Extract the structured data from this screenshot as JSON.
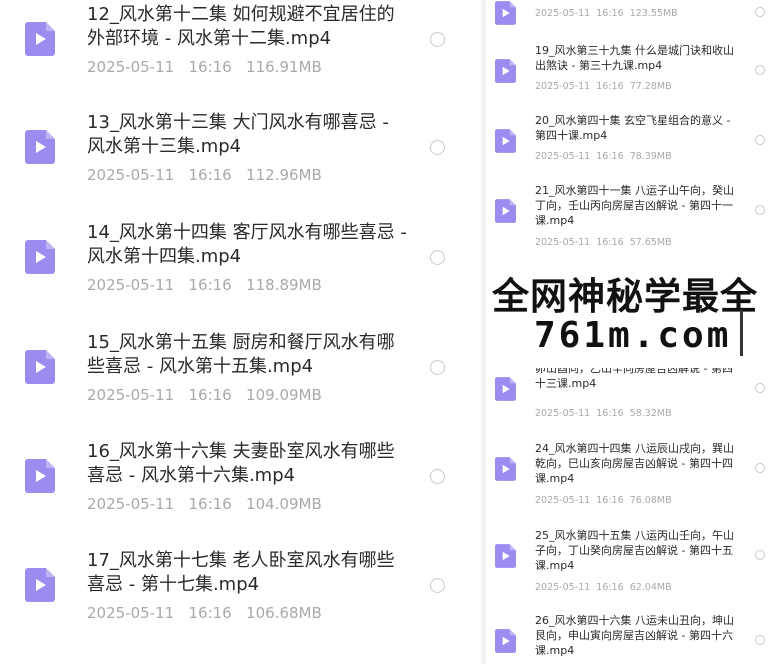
{
  "left_list": [
    {
      "title": "12_风水第十二集 如何规避不宜居住的外部环境 - 风水第十二集.mp4",
      "date": "2025-05-11",
      "time": "16:16",
      "size": "116.91MB"
    },
    {
      "title": "13_风水第十三集 大门风水有哪喜忌 - 风水第十三集.mp4",
      "date": "2025-05-11",
      "time": "16:16",
      "size": "112.96MB"
    },
    {
      "title": "14_风水第十四集 客厅风水有哪些喜忌 - 风水第十四集.mp4",
      "date": "2025-05-11",
      "time": "16:16",
      "size": "118.89MB"
    },
    {
      "title": "15_风水第十五集 厨房和餐厅风水有哪些喜忌 - 风水第十五集.mp4",
      "date": "2025-05-11",
      "time": "16:16",
      "size": "109.09MB"
    },
    {
      "title": "16_风水第十六集 夫妻卧室风水有哪些喜忌 - 风水第十六集.mp4",
      "date": "2025-05-11",
      "time": "16:16",
      "size": "104.09MB"
    },
    {
      "title": "17_风水第十七集 老人卧室风水有哪些喜忌 - 第十七集.mp4",
      "date": "2025-05-11",
      "time": "16:16",
      "size": "106.68MB"
    }
  ],
  "right_list": [
    {
      "title": "",
      "date": "2025-05-11",
      "time": "16:16",
      "size": "123.55MB"
    },
    {
      "title": "19_风水第三十九集 什么是城门诀和收山出煞诀 - 第三十九课.mp4",
      "date": "2025-05-11",
      "time": "16:16",
      "size": "77.28MB"
    },
    {
      "title": "20_风水第四十集 玄空飞星组合的意义 - 第四十课.mp4",
      "date": "2025-05-11",
      "time": "16:16",
      "size": "78.39MB"
    },
    {
      "title": "21_风水第四十一集 八运子山午向，癸山丁向，壬山丙向房屋吉凶解说 - 第四十一课.mp4",
      "date": "2025-05-11",
      "time": "16:16",
      "size": "57.65MB"
    },
    {
      "title": "卯山酉向，乙山辛向房屋吉凶解说 - 第四十三课.mp4",
      "date": "2025-05-11",
      "time": "16:16",
      "size": "58.32MB"
    },
    {
      "title": "24_风水第四十四集 八运辰山戌向，巽山乾向，巳山亥向房屋吉凶解说 - 第四十四课.mp4",
      "date": "2025-05-11",
      "time": "16:16",
      "size": "76.08MB"
    },
    {
      "title": "25_风水第四十五集 八运丙山壬向，午山子向，丁山癸向房屋吉凶解说 - 第四十五课.mp4",
      "date": "2025-05-11",
      "time": "16:16",
      "size": "62.04MB"
    },
    {
      "title": "26_风水第四十六集 八运未山丑向，坤山艮向，申山寅向房屋吉凶解说 - 第四十六课.mp4",
      "date": "",
      "time": "",
      "size": ""
    }
  ],
  "watermark": {
    "line1": "全网神秘学最全",
    "line2": "761m.com"
  },
  "icon": {
    "name": "video-file-icon",
    "color": "#9b8cf0",
    "play_color": "#ffffff"
  }
}
